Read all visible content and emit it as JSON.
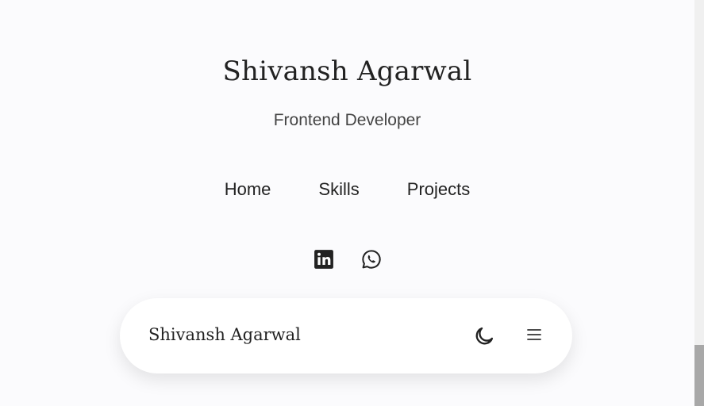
{
  "header": {
    "name": "Shivansh Agarwal",
    "role": "Frontend Developer"
  },
  "nav": {
    "items": [
      {
        "label": "Home"
      },
      {
        "label": "Skills"
      },
      {
        "label": "Projects"
      }
    ]
  },
  "social": {
    "icons": [
      "linkedin-icon",
      "whatsapp-icon"
    ]
  },
  "bottom_bar": {
    "name": "Shivansh Agarwal",
    "icons": [
      "moon-icon",
      "menu-icon"
    ]
  },
  "colors": {
    "background": "#fbfbfd",
    "text": "#222222",
    "card": "#ffffff",
    "scroll_thumb": "#a8a8a8"
  }
}
